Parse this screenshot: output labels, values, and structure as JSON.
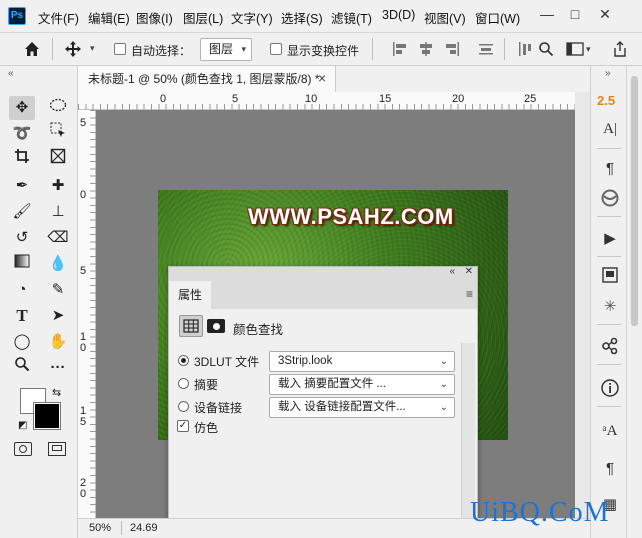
{
  "app": {
    "logo": "Ps"
  },
  "menu": [
    "文件(F)",
    "编辑(E)",
    "图像(I)",
    "图层(L)",
    "文字(Y)",
    "选择(S)",
    "滤镜(T)",
    "3D(D)",
    "视图(V)",
    "窗口(W)"
  ],
  "window_controls": {
    "minimize": "—",
    "maximize": "□",
    "close": "✕"
  },
  "options_bar": {
    "auto_select_label": "自动选择：",
    "auto_select_value": "图层",
    "show_transform_label": "显示变换控件"
  },
  "document": {
    "tab_title": "未标题-1 @ 50% (颜色查找 1, 图层蒙版/8) *",
    "close": "×",
    "zoom": "50%",
    "status_info": "24.69"
  },
  "rulers": {
    "h_ticks": [
      "0",
      "5",
      "10",
      "15",
      "20",
      "25"
    ],
    "v_ticks": [
      "5",
      "0",
      "5",
      "1 0",
      "1 5",
      "2 0"
    ]
  },
  "image": {
    "watermark_text": "WWW.PSAHZ.COM"
  },
  "properties_panel": {
    "tab_label": "属性",
    "adjustment_title": "颜色查找",
    "options": [
      {
        "label": "3DLUT 文件",
        "selected": true,
        "value": "3Strip.look"
      },
      {
        "label": "摘要",
        "selected": false,
        "value": "载入 摘要配置文件 ..."
      },
      {
        "label": "设备链接",
        "selected": false,
        "value": "载入 设备链接配置文件..."
      }
    ],
    "dither_label": "仿色",
    "dither_checked": true
  },
  "right_panel": {
    "version_label": "2.5"
  },
  "corner_logo": "UiBQ.CoM",
  "colors": {
    "accent_orange": "#e8850c",
    "logo_blue": "#1a73d9",
    "canvas_gray": "#7d7d7d"
  }
}
